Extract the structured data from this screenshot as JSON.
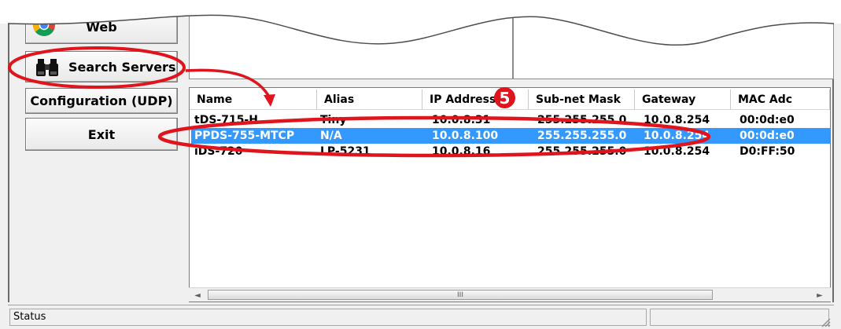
{
  "buttons": {
    "web": "Web",
    "search": "Search Servers",
    "config": "Configuration (UDP)",
    "exit": "Exit"
  },
  "table": {
    "columns": [
      "Name",
      "Alias",
      "IP Address",
      "Sub-net Mask",
      "Gateway",
      "MAC Adc"
    ],
    "rows": [
      [
        "tDS-715-H",
        "Tiny",
        "10.0.8.31",
        "255.255.255.0",
        "10.0.8.254",
        "00:0d:e0"
      ],
      [
        "PPDS-755-MTCP",
        "N/A",
        "10.0.8.100",
        "255.255.255.0",
        "10.0.8.254",
        "00:0d:e0"
      ],
      [
        "iDS-720",
        "LP-5231",
        "10.0.8.16",
        "255.255.255.0",
        "10.0.8.254",
        "D0:FF:50"
      ]
    ],
    "selected_row": 1
  },
  "scrollbar": {
    "thumb_label": "III",
    "left_arrow": "◄",
    "right_arrow": "►"
  },
  "status": {
    "label": "Status"
  },
  "annotation": {
    "step": "5"
  },
  "icons": {
    "web": "chrome-icon",
    "search": "binoculars-icon"
  },
  "colors": {
    "selection": "#3399ff",
    "annotation": "#e0141c"
  }
}
